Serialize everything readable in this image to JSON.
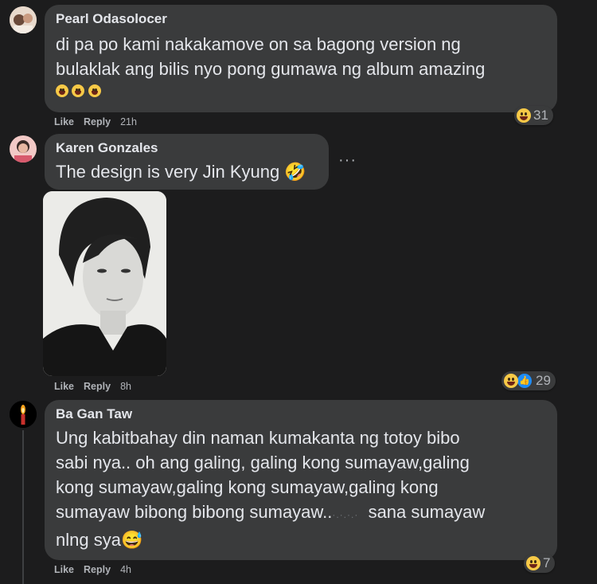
{
  "comments": [
    {
      "author": "Pearl Odasolocer",
      "text_lines": [
        "di pa po kami nakakamove on sa bagong version ng",
        "bulaklak ang bilis nyo pong gumawa ng album amazing"
      ],
      "emoji_line": "🥺🥺🥺",
      "actions": {
        "like": "Like",
        "reply": "Reply",
        "time": "21h"
      },
      "reaction_count": "31",
      "avatar_icon": "profile-photo"
    },
    {
      "author": "Karen Gonzales",
      "text_lines": [
        "The design is very Jin Kyung 🤣"
      ],
      "more": "···",
      "actions": {
        "like": "Like",
        "reply": "Reply",
        "time": "8h"
      },
      "reaction_count": "29",
      "avatar_icon": "profile-photo"
    },
    {
      "author": "Ba Gan Taw",
      "text_lines": [
        "Ung kabitbahay din naman kumakanta ng totoy bibo",
        "sabi nya.. oh ang galing, galing kong sumayaw,galing",
        "kong sumayaw,galing kong sumayaw,galing kong",
        "sumayaw bibong bibong sumayaw..",
        "nlng sya😅"
      ],
      "line4_tail": "sana sumayaw",
      "actions": {
        "like": "Like",
        "reply": "Reply",
        "time": "4h"
      },
      "reaction_count": "7",
      "avatar_icon": "candle-icon"
    }
  ],
  "colors": {
    "background": "#1c1c1d",
    "bubble": "#3a3b3c",
    "text": "#e4e6eb",
    "muted": "#b0b3b8",
    "like_blue": "#1d8cf8"
  }
}
